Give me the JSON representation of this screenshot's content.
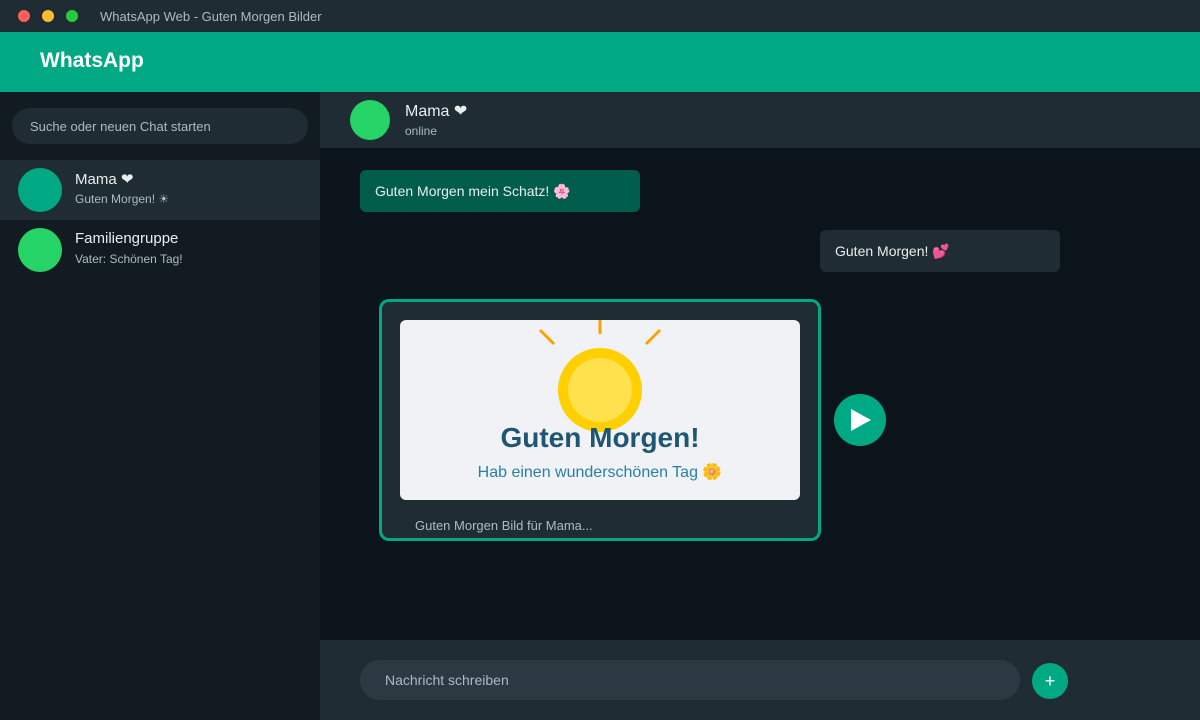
{
  "window": {
    "title": "WhatsApp Web - Guten Morgen Bilder"
  },
  "app": {
    "brand": "WhatsApp",
    "accent": "#00a884"
  },
  "sidebar": {
    "search_placeholder": "Suche oder neuen Chat starten",
    "chats": [
      {
        "name": "Mama ❤",
        "preview": "Guten Morgen! ☀",
        "avatar_color": "#00a884",
        "active": true
      },
      {
        "name": "Familiengruppe",
        "preview": "Vater: Schönen Tag!",
        "avatar_color": "#25d366",
        "active": false
      }
    ]
  },
  "chat": {
    "name": "Mama ❤",
    "status": "online",
    "messages": [
      {
        "direction": "outgoing",
        "text": "Guten Morgen mein Schatz! 🌸"
      },
      {
        "direction": "incoming",
        "text": "Guten Morgen! 💕"
      }
    ],
    "draft_image": {
      "title": "Guten Morgen!",
      "subtitle": "Hab einen wunderschönen Tag 🌼",
      "caption": "Guten Morgen Bild für Mama...",
      "icon": "sun-icon"
    }
  },
  "composer": {
    "placeholder": "Nachricht schreiben",
    "attach_label": "+",
    "send_icon": "send-icon"
  }
}
